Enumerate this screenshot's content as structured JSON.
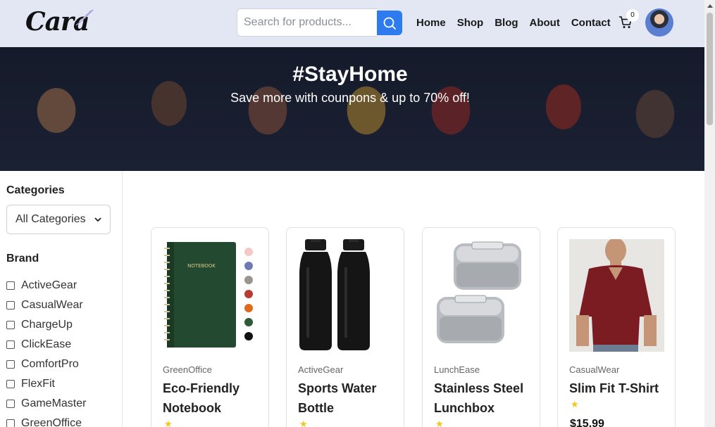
{
  "header": {
    "logo_text": "Cara",
    "search": {
      "placeholder": "Search for products...",
      "value": ""
    },
    "nav": [
      "Home",
      "Shop",
      "Blog",
      "About",
      "Contact"
    ],
    "cart_count": "0"
  },
  "hero": {
    "title": "#StayHome",
    "subtitle": "Save more with counpons & up to 70% off!"
  },
  "sidebar": {
    "categories_heading": "Categories",
    "category_selected": "All Categories",
    "brand_heading": "Brand",
    "brands": [
      "ActiveGear",
      "CasualWear",
      "ChargeUp",
      "ClickEase",
      "ComfortPro",
      "FlexFit",
      "GameMaster",
      "GreenOffice"
    ]
  },
  "products": [
    {
      "brand": "GreenOffice",
      "title": "Eco-Friendly Notebook",
      "rating": 1,
      "image": "notebook"
    },
    {
      "brand": "ActiveGear",
      "title": "Sports Water Bottle",
      "rating": 1,
      "image": "water-bottle"
    },
    {
      "brand": "LunchEase",
      "title": "Stainless Steel Lunchbox",
      "rating": 1,
      "image": "lunchbox"
    },
    {
      "brand": "CasualWear",
      "title": "Slim Fit T-Shirt",
      "rating": 1,
      "price": "$15.99",
      "image": "t-shirt"
    }
  ],
  "colors": {
    "header_bg": "#e3e6f3",
    "accent": "#2e7bf0",
    "star": "#f5c518"
  }
}
